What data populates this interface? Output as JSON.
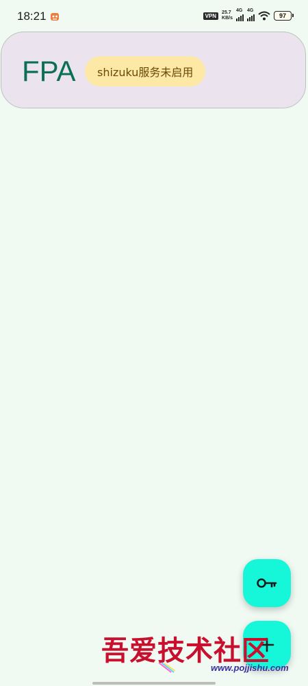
{
  "status_bar": {
    "time": "18:21",
    "vpn": "VPN",
    "net_speed_value": "25.7",
    "net_speed_unit": "KB/s",
    "sim1": "4G",
    "sim2": "4G",
    "battery": "97"
  },
  "header": {
    "title": "FPA",
    "status_chip": "shizuku服务未启用"
  },
  "fabs": {
    "key_icon": "key-icon",
    "add_icon": "add-icon",
    "color": "#15f7d8"
  },
  "watermark": {
    "title": "吾爱技术社区",
    "url": "www.pojjishu.com"
  },
  "colors": {
    "background": "#f0faf3",
    "header_bg": "#ebe4ef",
    "title": "#0b6e57",
    "chip_bg": "#fde8a6"
  }
}
